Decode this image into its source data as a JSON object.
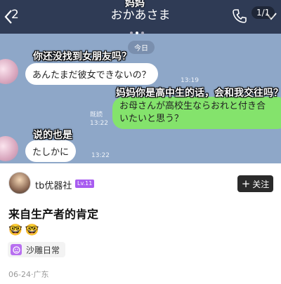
{
  "screenshot": {
    "overlay_title": "妈妈",
    "chat_title": "おかあさま",
    "unread_count": "2",
    "page_indicator": "1/1",
    "date_label": "今日",
    "messages": [
      {
        "direction": "in",
        "caption": "你还没找到女朋友吗？",
        "text": "あんたまだ彼女できないの？",
        "time": "13:19"
      },
      {
        "direction": "out",
        "caption": "妈妈你是高中生的话，会和我交往吗？",
        "line1": "お母さんが高校生ならおれと付き合",
        "line2": "いたいと思う？",
        "read": "既読",
        "time": "13:22"
      },
      {
        "direction": "in",
        "caption": "说的也是",
        "text": "たしかに",
        "time": "13:22"
      }
    ],
    "colors": {
      "header": "#2f3b55",
      "background": "#8ea7c8",
      "out_bubble": "#84e36c"
    }
  },
  "author": {
    "name": "tb优器社",
    "badge": "Lv.11"
  },
  "follow_label": "关注",
  "post": {
    "title": "来自生产者的肯定",
    "emojis": [
      "🤓",
      "🤓"
    ],
    "topic": "沙雕日常",
    "meta": "06-24·广东"
  }
}
